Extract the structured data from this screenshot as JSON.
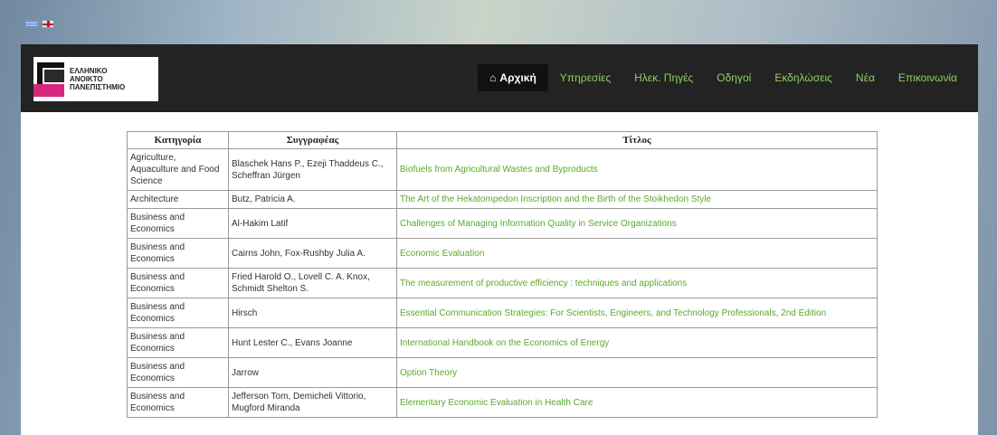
{
  "language_flags": [
    {
      "name": "greek-flag"
    },
    {
      "name": "uk-flag"
    }
  ],
  "logo": {
    "lines": [
      "ΕΛΛΗΝΙΚΟ",
      "ΑΝΟΙΚΤΟ",
      "ΠΑΝΕΠΙΣΤΗΜΙΟ"
    ]
  },
  "nav": {
    "items": [
      {
        "label": "Αρχική",
        "active": true
      },
      {
        "label": "Υπηρεσίες",
        "active": false
      },
      {
        "label": "Ηλεκ. Πηγές",
        "active": false
      },
      {
        "label": "Οδηγοί",
        "active": false
      },
      {
        "label": "Εκδηλώσεις",
        "active": false
      },
      {
        "label": "Νέα",
        "active": false
      },
      {
        "label": "Επικοινωνία",
        "active": false
      }
    ],
    "home_icon": "home-icon",
    "colors": {
      "link": "#8fd15a",
      "bar": "#232323"
    }
  },
  "table": {
    "headers": {
      "category": "Κατηγορία",
      "author": "Συγγραφέας",
      "title": "Τίτλος"
    },
    "rows": [
      {
        "category": "Agriculture, Aquaculture and Food Science",
        "author": "Blaschek Hans P., Ezeji Thaddeus C., Scheffran Jürgen",
        "title": "Biofuels from Agricultural Wastes and Byproducts"
      },
      {
        "category": "Architecture",
        "author": "Butz, Patricia A.",
        "title": "The Art of the Hekatompedon Inscription and the Birth of the Stoikhedon Style"
      },
      {
        "category": "Business and Economics",
        "author": "Al-Hakim Latif",
        "title": "Challenges of Managing Information Quality in Service Organizations"
      },
      {
        "category": "Business and Economics",
        "author": "Cairns John, Fox-Rushby Julia A.",
        "title": "Economic Evaluation"
      },
      {
        "category": "Business and Economics",
        "author": "Fried Harold O., Lovell C. A. Knox, Schmidt Shelton S.",
        "title": "The measurement of productive efficiency : techniques and applications"
      },
      {
        "category": "Business and Economics",
        "author": "Hirsch",
        "title": "Essential Communication Strategies: For Scientists, Engineers, and Technology Professionals, 2nd Edition"
      },
      {
        "category": "Business and Economics",
        "author": "Hunt Lester C., Evans Joanne",
        "title": "International Handbook on the Economics of Energy"
      },
      {
        "category": "Business and Economics",
        "author": "Jarrow",
        "title": "Option Theory"
      },
      {
        "category": "Business and Economics",
        "author": "Jefferson Tom, Demicheli Vittorio, Mugford Miranda",
        "title": "Elementary Economic Evaluation in Health Care"
      }
    ]
  }
}
